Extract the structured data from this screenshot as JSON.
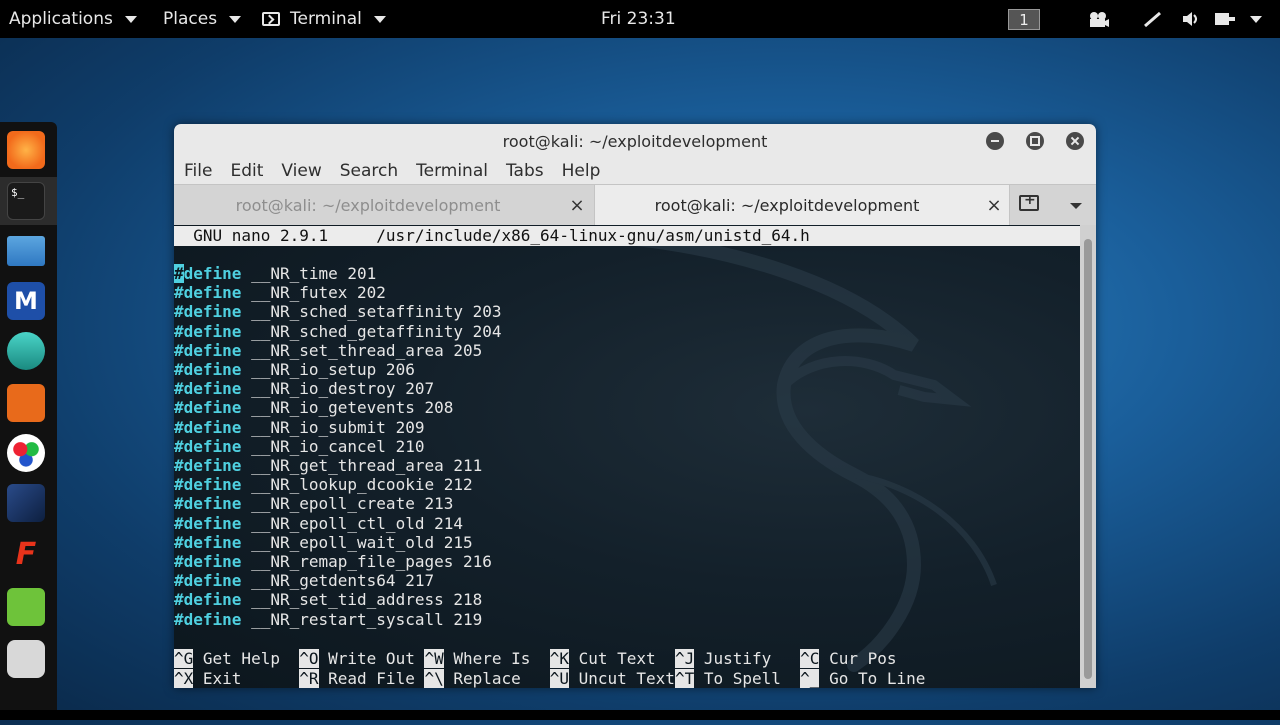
{
  "topbar": {
    "applications": "Applications",
    "places": "Places",
    "terminal": "Terminal",
    "clock": "Fri 23:31",
    "workspace": "1"
  },
  "dock": {
    "icons": [
      "firefox-icon",
      "terminal-icon",
      "files-icon",
      "metasploit-icon",
      "armitage-icon",
      "burpsuite-icon",
      "maltego-icon",
      "beef-icon",
      "faraday-icon",
      "leafpad-icon",
      "cherrytree-icon"
    ]
  },
  "window": {
    "title": "root@kali: ~/exploitdevelopment",
    "menu": [
      "File",
      "Edit",
      "View",
      "Search",
      "Terminal",
      "Tabs",
      "Help"
    ],
    "tabs": [
      {
        "label": "root@kali: ~/exploitdevelopment",
        "active": false
      },
      {
        "label": "root@kali: ~/exploitdevelopment",
        "active": true
      }
    ],
    "tab_close": "×"
  },
  "nano": {
    "header": "  GNU nano 2.9.1     /usr/include/x86_64-linux-gnu/asm/unistd_64.h",
    "keyword": "#define",
    "lines": [
      "__NR_time 201",
      "__NR_futex 202",
      "__NR_sched_setaffinity 203",
      "__NR_sched_getaffinity 204",
      "__NR_set_thread_area 205",
      "__NR_io_setup 206",
      "__NR_io_destroy 207",
      "__NR_io_getevents 208",
      "__NR_io_submit 209",
      "__NR_io_cancel 210",
      "__NR_get_thread_area 211",
      "__NR_lookup_dcookie 212",
      "__NR_epoll_create 213",
      "__NR_epoll_ctl_old 214",
      "__NR_epoll_wait_old 215",
      "__NR_remap_file_pages 216",
      "__NR_getdents64 217",
      "__NR_set_tid_address 218",
      "__NR_restart_syscall 219"
    ],
    "shortcuts_row1": [
      {
        "key": "^G",
        "label": "Get Help"
      },
      {
        "key": "^O",
        "label": "Write Out"
      },
      {
        "key": "^W",
        "label": "Where Is"
      },
      {
        "key": "^K",
        "label": "Cut Text"
      },
      {
        "key": "^J",
        "label": "Justify"
      },
      {
        "key": "^C",
        "label": "Cur Pos"
      }
    ],
    "shortcuts_row2": [
      {
        "key": "^X",
        "label": "Exit"
      },
      {
        "key": "^R",
        "label": "Read File"
      },
      {
        "key": "^\\",
        "label": "Replace"
      },
      {
        "key": "^U",
        "label": "Uncut Text"
      },
      {
        "key": "^T",
        "label": "To Spell"
      },
      {
        "key": "^_",
        "label": "Go To Line"
      }
    ]
  }
}
